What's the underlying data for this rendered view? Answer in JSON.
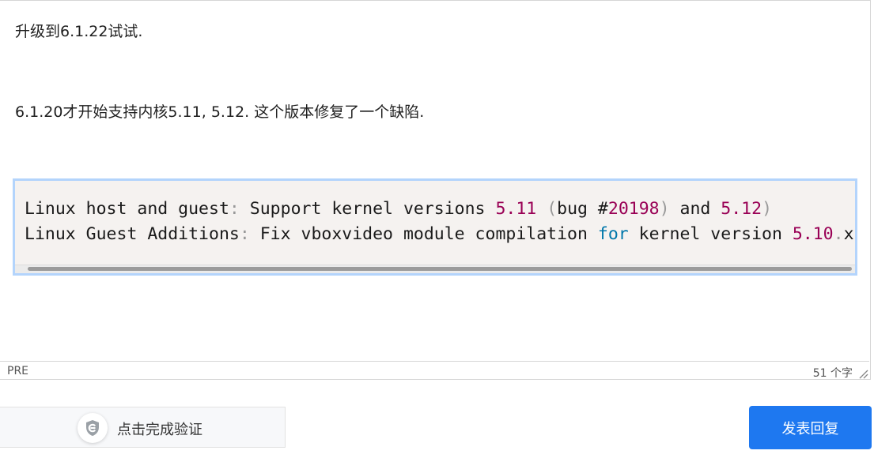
{
  "editor": {
    "paragraphs": [
      "升级到6.1.22试试.",
      "6.1.20才开始支持内核5.11, 5.12. 这个版本修复了一个缺陷."
    ],
    "code": {
      "line1": {
        "t1": "Linux host and guest",
        "t2": ":",
        "t3": " Support kernel versions ",
        "t4": "5.11",
        "t5": " ",
        "t6": "(",
        "t7": "bug #",
        "t8": "20198",
        "t9": ")",
        "t10": " and ",
        "t11": "5.12",
        "t12": ")"
      },
      "line2": {
        "t1": "Linux Guest Additions",
        "t2": ":",
        "t3": " Fix vboxvideo module compilation ",
        "t4": "for",
        "t5": " kernel version ",
        "t6": "5.10",
        "t7": ".",
        "t8": "x"
      }
    }
  },
  "statusbar": {
    "path": "PRE",
    "word_count": "51 个字"
  },
  "captcha": {
    "label": "点击完成验证"
  },
  "actions": {
    "submit_label": "发表回复"
  },
  "colors": {
    "submit": "#1e78f0",
    "code_bg": "#f5f2f0",
    "code_border": "#b3d4fc",
    "number": "#990055",
    "keyword": "#0077aa",
    "punctuation": "#999999"
  },
  "icons": {
    "captcha": "shield-check-icon",
    "resize": "resize-handle-icon"
  }
}
